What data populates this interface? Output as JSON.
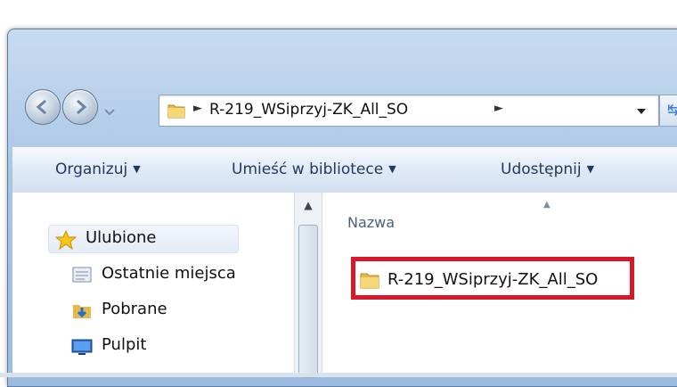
{
  "address_bar": {
    "breadcrumb": "R-219_WSiprzyj-ZK_All_SO",
    "separator": "►"
  },
  "command_bar": {
    "items": [
      "Organizuj",
      "Umieść w bibliotece",
      "Udostępnij"
    ]
  },
  "nav_pane": {
    "favorites_label": "Ulubione",
    "items": [
      "Ostatnie miejsca",
      "Pobrane",
      "Pulpit"
    ]
  },
  "file_list": {
    "column_header": "Nazwa",
    "items": [
      {
        "name": "R-219_WSiprzyj-ZK_All_SO",
        "highlighted": true
      }
    ]
  },
  "colors": {
    "highlight_border": "#d7182a",
    "command_text": "#1e395b",
    "window_frame": "#aac6e6"
  },
  "icons": {
    "back": "back-arrow-icon",
    "forward": "forward-arrow-icon",
    "folder": "folder-icon",
    "favorites": "star-icon",
    "recent": "recent-places-icon",
    "downloads": "downloads-icon",
    "desktop": "desktop-icon",
    "refresh": "refresh-icon"
  }
}
